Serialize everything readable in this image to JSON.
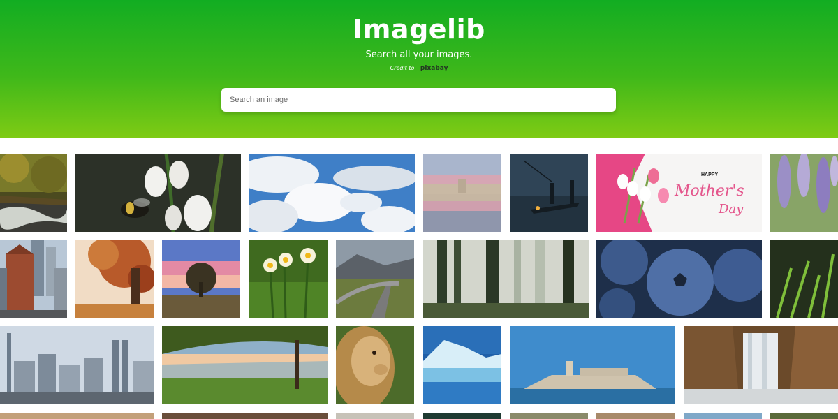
{
  "header": {
    "title": "Imagelib",
    "subtitle": "Search all your images.",
    "credit_text": "Credit to",
    "credit_logo": "pixabay"
  },
  "search": {
    "placeholder": "Search an image",
    "value": ""
  },
  "colors": {
    "header_top": "#12ad22",
    "header_bottom": "#7ecb14",
    "background": "#ffffff"
  },
  "gallery": {
    "images": [
      {
        "name": "forest-stream-image"
      },
      {
        "name": "bumblebee-flower-image"
      },
      {
        "name": "clouds-sky-image"
      },
      {
        "name": "palace-reflection-image"
      },
      {
        "name": "fishermen-boat-image"
      },
      {
        "name": "mothers-day-image",
        "text_happy": "HAPPY",
        "text_main": "Mother's",
        "text_day": "Day"
      },
      {
        "name": "wisteria-flowers-image"
      },
      {
        "name": "city-skyscrapers-image"
      },
      {
        "name": "autumn-tree-image"
      },
      {
        "name": "sunset-tree-image"
      },
      {
        "name": "daffodils-image"
      },
      {
        "name": "mountain-road-image"
      },
      {
        "name": "misty-forest-image"
      },
      {
        "name": "blueberries-image"
      },
      {
        "name": "grass-rain-image"
      },
      {
        "name": "city-skyline-image"
      },
      {
        "name": "beach-tree-image"
      },
      {
        "name": "lion-image"
      },
      {
        "name": "iceberg-image"
      },
      {
        "name": "island-castle-image"
      },
      {
        "name": "waterfall-image"
      }
    ]
  }
}
